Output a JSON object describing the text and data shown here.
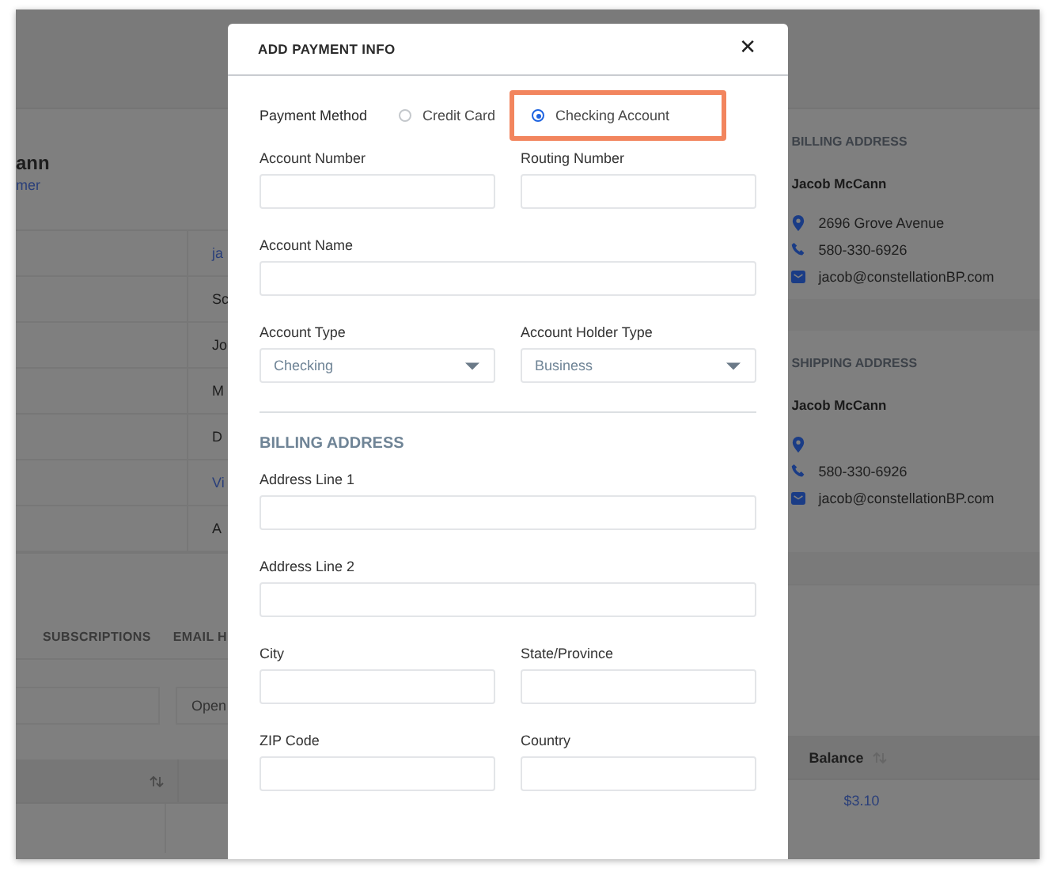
{
  "background": {
    "customer": {
      "name": "ann",
      "link": "mer"
    },
    "details": [
      {
        "kind": "link",
        "text": "ja"
      },
      {
        "kind": "text",
        "text": "Sc"
      },
      {
        "kind": "text",
        "text": "Jo"
      },
      {
        "kind": "text",
        "text": "M"
      },
      {
        "kind": "text",
        "text": "D"
      },
      {
        "kind": "link",
        "text": "Vi"
      },
      {
        "kind": "text",
        "text": "A"
      }
    ],
    "tabs": [
      "SUBSCRIPTIONS",
      "EMAIL H"
    ],
    "filter": {
      "status": "Open"
    },
    "table": {
      "columns": [
        {
          "sortable": true
        },
        {
          "label": "Balance",
          "sortable": true
        }
      ],
      "rows": [
        {
          "balance": "$3.10"
        }
      ]
    },
    "cards": [
      {
        "title": "BILLING ADDRESS",
        "name": "Jacob McCann",
        "lines": [
          {
            "kind": "address",
            "text": "2696 Grove Avenue"
          },
          {
            "kind": "phone",
            "text": "580-330-6926"
          },
          {
            "kind": "email",
            "text": "jacob@constellationBP.com"
          }
        ]
      },
      {
        "title": "SHIPPING ADDRESS",
        "name": "Jacob McCann",
        "lines": [
          {
            "kind": "address"
          },
          {
            "kind": "phone",
            "text": "580-330-6926"
          },
          {
            "kind": "email",
            "text": "jacob@constellationBP.com"
          }
        ]
      }
    ]
  },
  "modal": {
    "title": "ADD PAYMENT INFO",
    "close": "✕",
    "payment_method": {
      "label": "Payment Method",
      "options": [
        {
          "label": "Credit Card",
          "selected": false,
          "highlighted": false
        },
        {
          "label": "Checking Account",
          "selected": true,
          "highlighted": true
        }
      ]
    },
    "sections": [
      {
        "rows": [
          [
            {
              "label": "Account Number",
              "kind": "text"
            },
            {
              "label": "Routing Number",
              "kind": "text"
            }
          ],
          [
            {
              "label": "Account Name",
              "kind": "text"
            }
          ],
          [
            {
              "label": "Account Type",
              "kind": "select",
              "value": "Checking"
            },
            {
              "label": "Account Holder Type",
              "kind": "select",
              "value": "Business"
            }
          ]
        ]
      },
      {
        "title": "BILLING ADDRESS",
        "rows": [
          [
            {
              "label": "Address Line 1",
              "kind": "text"
            }
          ],
          [
            {
              "label": "Address Line 2",
              "kind": "text"
            }
          ],
          [
            {
              "label": "City",
              "kind": "text"
            },
            {
              "label": "State/Province",
              "kind": "text"
            }
          ],
          [
            {
              "label": "ZIP Code",
              "kind": "text"
            },
            {
              "label": "Country",
              "kind": "text"
            }
          ]
        ]
      }
    ]
  }
}
